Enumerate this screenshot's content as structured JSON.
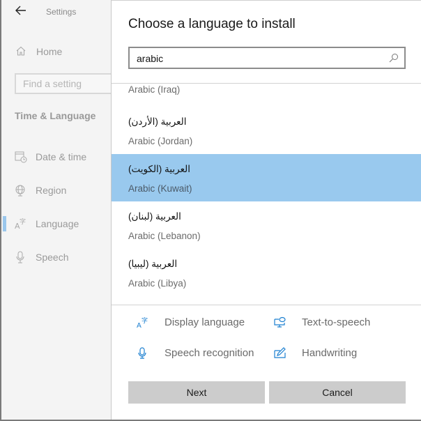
{
  "window": {
    "app_title": "Settings"
  },
  "sidebar": {
    "home_label": "Home",
    "search_placeholder": "Find a setting",
    "section_title": "Time & Language",
    "items": [
      {
        "label": "Date & time",
        "icon": "calendar-clock-icon",
        "active": false
      },
      {
        "label": "Region",
        "icon": "globe-icon",
        "active": false
      },
      {
        "label": "Language",
        "icon": "language-icon",
        "active": true
      },
      {
        "label": "Speech",
        "icon": "microphone-icon",
        "active": false
      }
    ]
  },
  "dialog": {
    "title": "Choose a language to install",
    "search": {
      "value": "arabic",
      "icon": "search-icon"
    },
    "languages": [
      {
        "native": "",
        "english": "Arabic (Iraq)",
        "selected": false,
        "partial": true
      },
      {
        "native": "العربية (الأردن)",
        "english": "Arabic (Jordan)",
        "selected": false
      },
      {
        "native": "العربية (الكويت)",
        "english": "Arabic (Kuwait)",
        "selected": true
      },
      {
        "native": "العربية (لبنان)",
        "english": "Arabic (Lebanon)",
        "selected": false
      },
      {
        "native": "العربية (ليبيا)",
        "english": "Arabic (Libya)",
        "selected": false
      }
    ],
    "features": [
      {
        "label": "Display language",
        "icon": "display-language-icon"
      },
      {
        "label": "Text-to-speech",
        "icon": "text-to-speech-icon"
      },
      {
        "label": "Speech recognition",
        "icon": "speech-recognition-icon"
      },
      {
        "label": "Handwriting",
        "icon": "handwriting-icon"
      }
    ],
    "buttons": {
      "next": "Next",
      "cancel": "Cancel"
    }
  },
  "colors": {
    "selected_row": "#99c9ee",
    "feature_icon": "#1b7fd0",
    "button_bg": "#cccccc"
  }
}
